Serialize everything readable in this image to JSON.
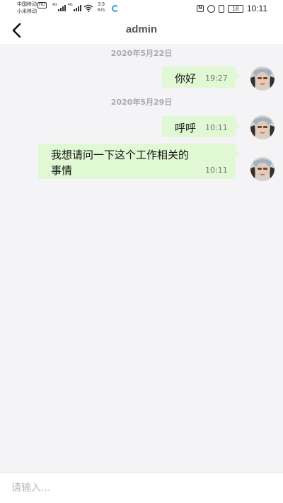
{
  "status_bar": {
    "carrier_1": "中国移动",
    "hd_badge": "HD",
    "carrier_2": "小米移动",
    "network_1": "4G",
    "network_2": "4G",
    "speed_value": "3.9",
    "speed_unit": "K/s",
    "nfc_label": "N",
    "battery": "18",
    "time": "10:11"
  },
  "nav": {
    "title": "admin"
  },
  "messages": [
    {
      "date": "2020年5月22日"
    },
    {
      "text": "你好",
      "time": "19:27"
    },
    {
      "date": "2020年5月29日"
    },
    {
      "text": "呼呼",
      "time": "10:11"
    },
    {
      "text_line1": "我想请问一下这个工作相关的",
      "text_line2": "事情",
      "time": "10:11"
    }
  ],
  "input": {
    "placeholder": "请输入..."
  },
  "colors": {
    "bubble": "#e0f8d3",
    "background": "#f4f4f6",
    "date_text": "#a9a9ae"
  }
}
